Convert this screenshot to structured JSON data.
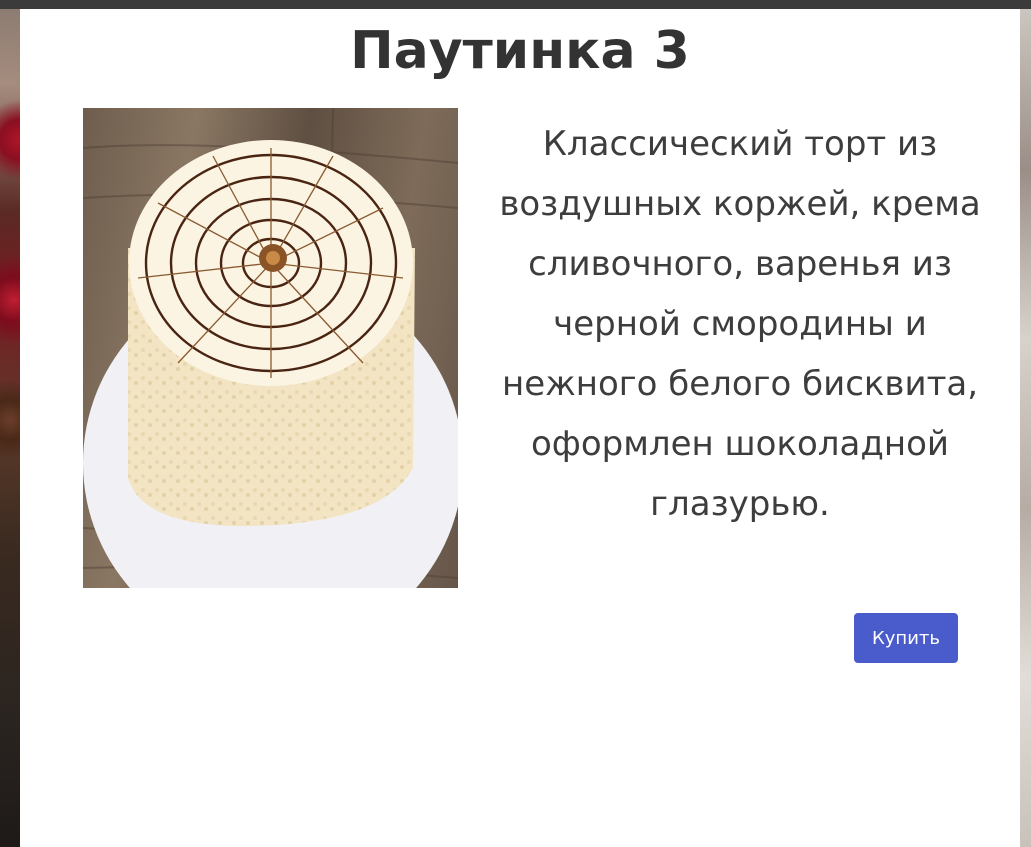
{
  "product": {
    "title": "Паутинка 3",
    "description": "Классический торт из воздушных коржей, крема сливочного, варенья из черной смородины и нежного белого бисквита, оформлен шоколадной глазурью.",
    "image_subject": "cake-photo",
    "buy_label": "Купить"
  },
  "colors": {
    "accent": "#4a5ccc",
    "text": "#333333",
    "panel": "#ffffff",
    "top_bar": "#3b3b3b"
  }
}
